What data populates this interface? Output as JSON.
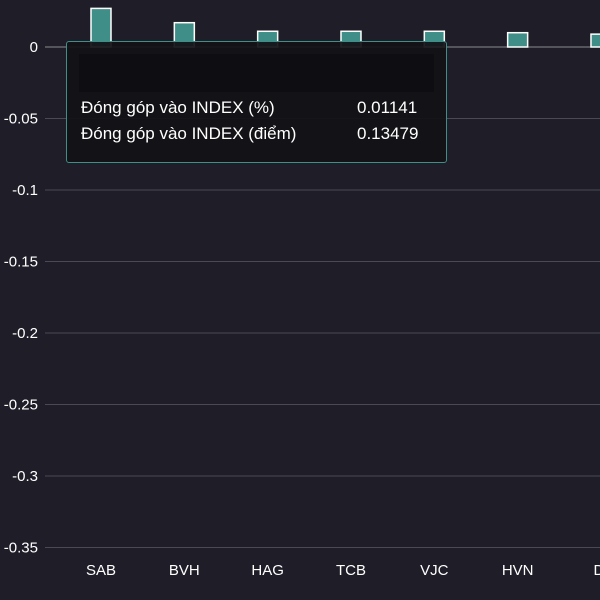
{
  "chart_data": {
    "type": "bar",
    "categories": [
      "SAB",
      "BVH",
      "HAG",
      "TCB",
      "VJC",
      "HVN",
      "DI"
    ],
    "series": [
      {
        "values": [
          0.027,
          0.017,
          0.011,
          0.011,
          0.011,
          0.01,
          0.009
        ]
      }
    ],
    "yticks": [
      0,
      -0.05,
      -0.1,
      -0.15,
      -0.2,
      -0.25,
      -0.3,
      -0.35
    ],
    "ytick_labels": [
      "0",
      "-0.05",
      "-0.1",
      "-0.15",
      "-0.2",
      "-0.25",
      "-0.3",
      "-0.35"
    ],
    "ylim": [
      -0.35,
      0.033
    ],
    "grid": true,
    "colors": {
      "background": "#1f1e28",
      "bar_fill": "#3f8f88",
      "bar_stroke": "#ffffff",
      "grid": "#4a4a54",
      "text": "#ffffff"
    }
  },
  "tooltip": {
    "header": "",
    "rows": [
      {
        "label": "Đóng góp vào INDEX (%)",
        "value": "0.01141"
      },
      {
        "label": "Đóng góp vào INDEX (điểm)",
        "value": "0.13479"
      }
    ]
  }
}
